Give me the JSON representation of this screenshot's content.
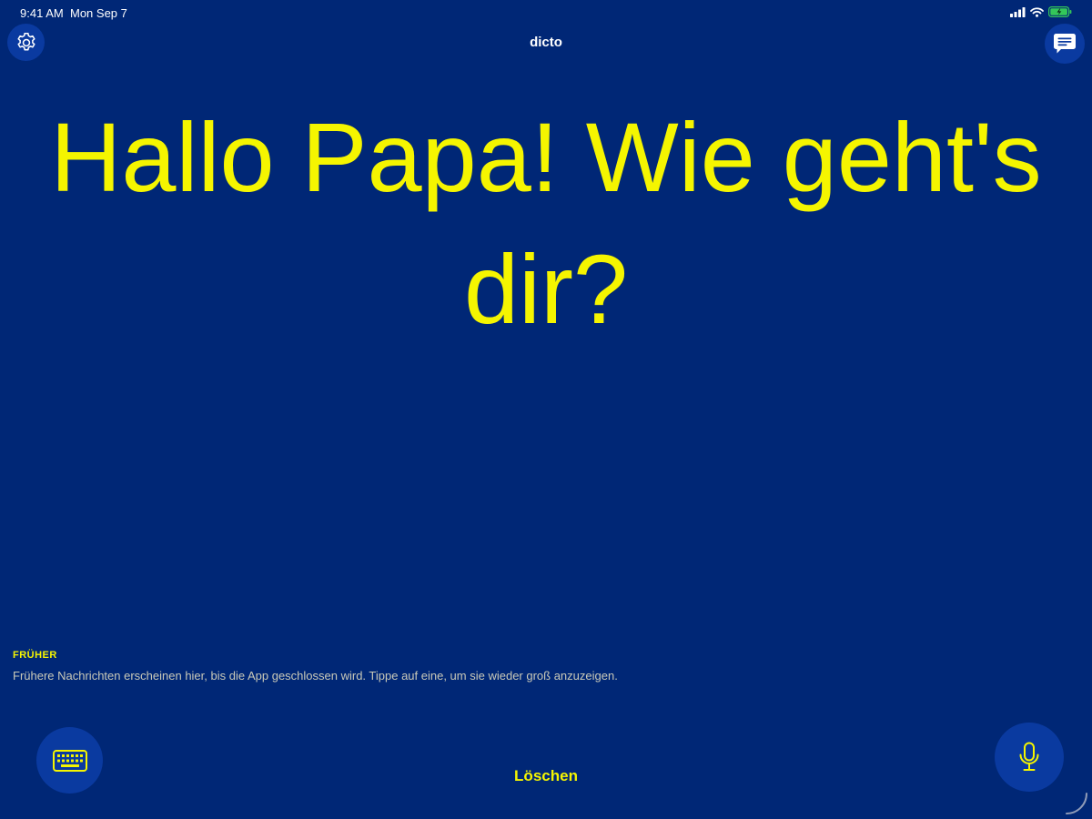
{
  "status_bar": {
    "time": "9:41 AM",
    "date": "Mon Sep 7"
  },
  "app": {
    "title": "dicto"
  },
  "main": {
    "message": "Hallo Papa! Wie geht's dir?"
  },
  "history": {
    "heading": "FRÜHER",
    "hint": "Frühere Nachrichten erscheinen hier, bis die App geschlossen wird. Tippe auf eine, um sie wieder groß anzuzeigen."
  },
  "toolbar": {
    "clear_label": "Löschen"
  },
  "icons": {
    "settings": "gear-icon",
    "chat": "chat-bubble-icon",
    "keyboard": "keyboard-icon",
    "microphone": "microphone-icon"
  },
  "colors": {
    "background": "#002776",
    "accent": "#f5f500",
    "button": "#0a3aa0",
    "battery": "#34c759"
  }
}
